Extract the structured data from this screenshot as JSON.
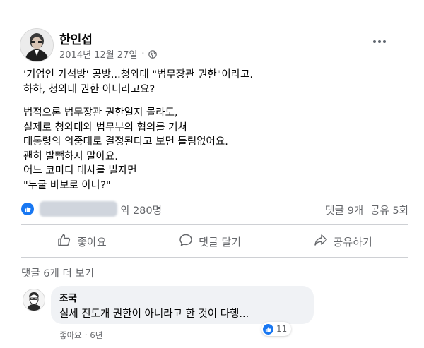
{
  "post": {
    "author": "한인섭",
    "date": "2014년 12월 27일",
    "date_separator": "·",
    "privacy_icon": "globe-icon",
    "menu_icon": "more-options-icon",
    "body": [
      "'기업인 가석방' 공방...청와대 \"법무장관 권한\"이라고.",
      "하하, 청와대 권한 아니라고요?",
      "법적으론 법무장관 권한일지 몰라도,",
      "실제로 청와대와 법무부의 협의를 거쳐",
      "대통령의 의중대로 결정된다고 보면 틀림없어요.",
      "괜히 발뺌하지 말아요.",
      "어느 코미디 대사를 빌자면",
      "\"누굴 바보로 아나?\""
    ]
  },
  "stats": {
    "likes_text": "외 280명",
    "comments": "댓글 9개",
    "shares": "공유 5회"
  },
  "actions": {
    "like": "좋아요",
    "comment": "댓글 달기",
    "share": "공유하기"
  },
  "more_comments": "댓글 6개 더 보기",
  "comment": {
    "author": "조국",
    "text": "실세 진도개 권한이 아니라고 한 것이 다행...",
    "reaction_count": "11",
    "like_label": "좋아요",
    "separator": "·",
    "time": "6년"
  },
  "colors": {
    "facebook_blue": "#1877f2",
    "secondary_text": "#65676b",
    "bubble": "#f0f2f5"
  }
}
